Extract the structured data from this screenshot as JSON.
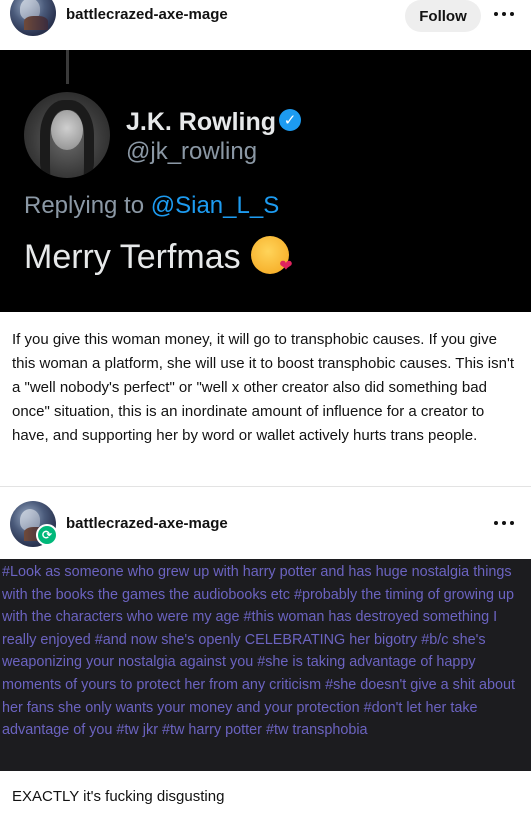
{
  "post1": {
    "username": "battlecrazed-axe-mage",
    "follow_label": "Follow"
  },
  "tweet": {
    "name": "J.K. Rowling",
    "handle": "@jk_rowling",
    "replying_prefix": "Replying to",
    "replying_mention": "@Sian_L_S",
    "text": "Merry Terfmas",
    "emoji": "face-blowing-a-kiss-icon"
  },
  "post1_body": "If you give this woman money, it will go to transphobic causes. If you give this woman a platform, she will use it to boost transphobic causes. This isn't a \"well nobody's perfect\" or \"well x other creator also did something bad once\" situation, this is an inordinate amount of influence for a creator to have, and supporting her by word or wallet actively hurts trans people.",
  "post2": {
    "username": "battlecrazed-axe-mage",
    "tags": "#Look as someone who grew up with harry potter and has huge nostalgia things with the books the games the audiobooks etc #probably the timing of growing up with the characters who were my age #this woman has destroyed something I really enjoyed #and now she's openly CELEBRATING her bigotry #b/c she's weaponizing your nostalgia against you #she is taking advantage of happy moments of yours to protect her from any criticism #she doesn't give a shit about her fans she only wants your money and your protection #don't let her take advantage of you #tw jkr #tw harry potter #tw transphobia",
    "reply": "EXACTLY it's fucking disgusting"
  },
  "colors": {
    "tag_text": "#6b63c0",
    "tag_background": "#1c1c1f",
    "verified": "#1d9bf0",
    "reblog": "#00b87a"
  }
}
